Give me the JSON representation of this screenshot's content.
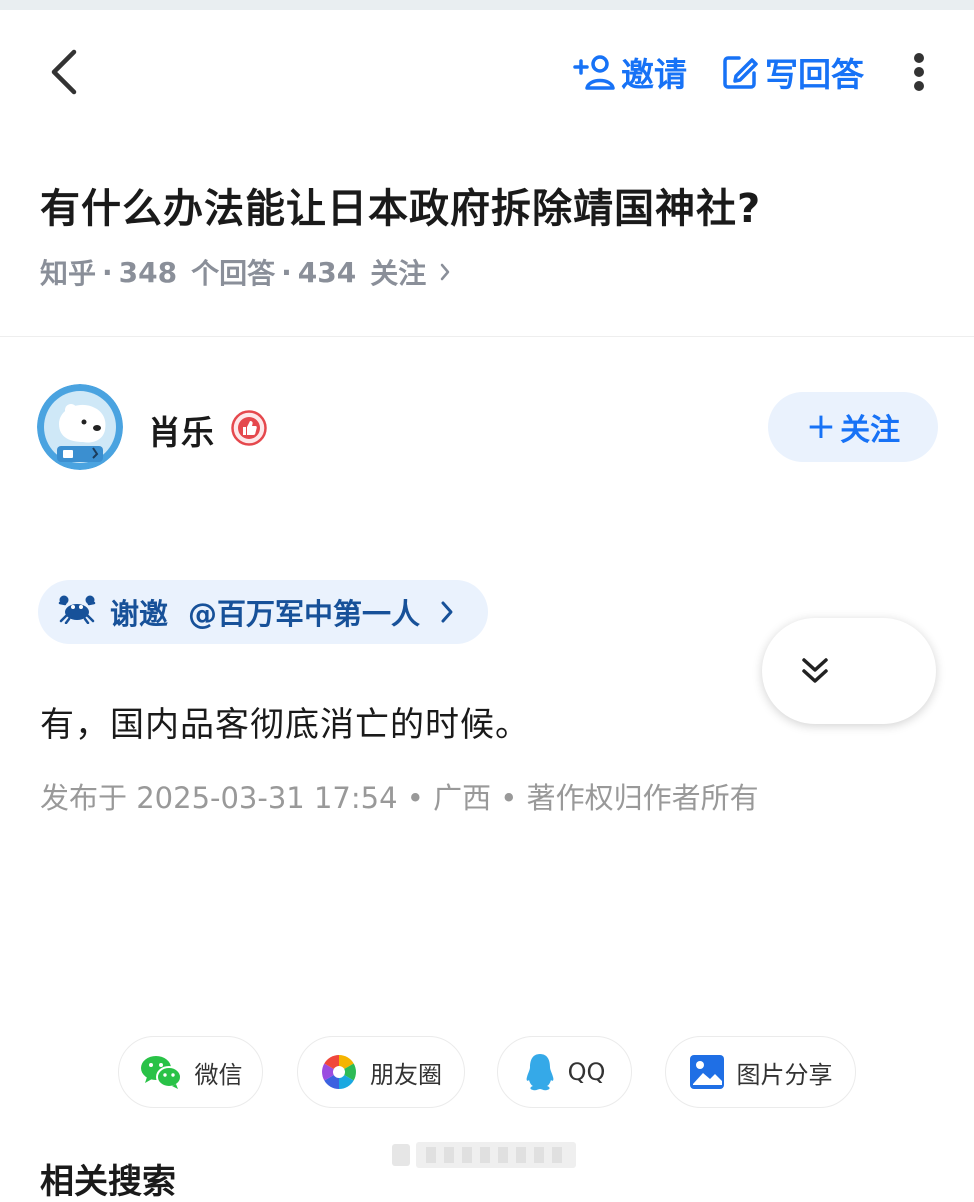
{
  "header": {
    "invite_label": "邀请",
    "write_answer_label": "写回答"
  },
  "question": {
    "title": "有什么办法能让日本政府拆除靖国神社?",
    "source": "知乎",
    "answer_count": "348",
    "answer_suffix": "个回答",
    "follower_count": "434",
    "follower_suffix": "关注",
    "separator": "·"
  },
  "author": {
    "name": "肖乐",
    "follow_label": "关注",
    "follow_plus": "+"
  },
  "invite": {
    "label": "谢邀",
    "mention": "@百万军中第一人"
  },
  "answer": {
    "text": "有，国内品客彻底消亡的时候。",
    "meta": "发布于  2025-03-31  17:54 • 广西 • 著作权归作者所有"
  },
  "share": {
    "items": [
      {
        "label": "微信",
        "icon": "wechat-icon"
      },
      {
        "label": "朋友圈",
        "icon": "moments-icon"
      },
      {
        "label": "QQ",
        "icon": "qq-icon"
      },
      {
        "label": "图片分享",
        "icon": "image-share-icon"
      }
    ]
  },
  "related": {
    "title": "相关搜索"
  },
  "colors": {
    "accent": "#1772f6",
    "chip_bg": "#eaf2fd",
    "chip_text": "#175199",
    "meta_gray": "#8a8f99"
  }
}
